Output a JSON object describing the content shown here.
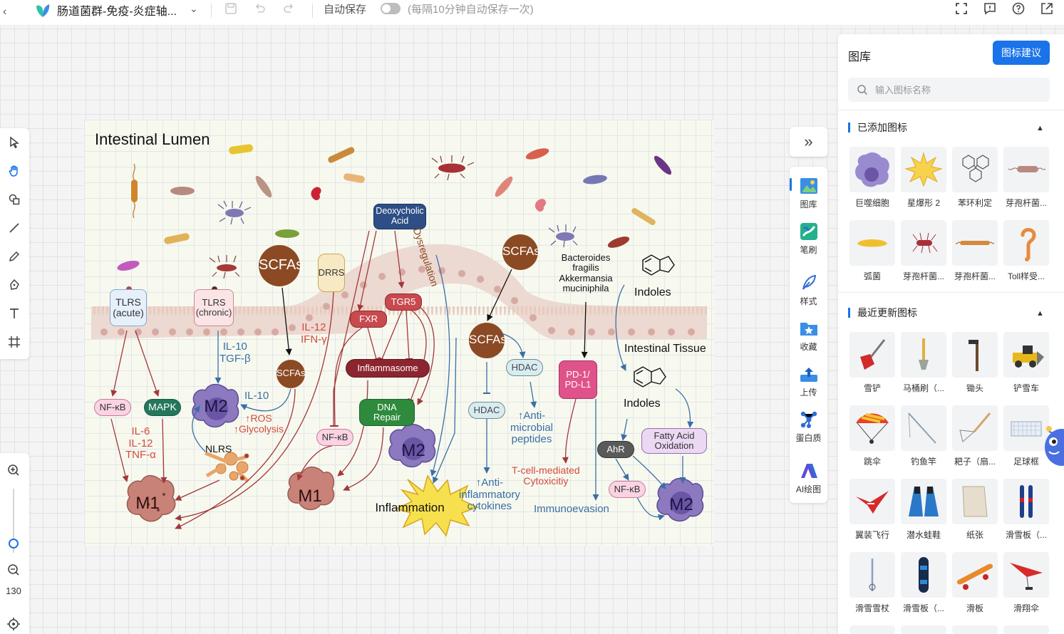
{
  "topbar": {
    "back": "‹",
    "doc_title": "肠道菌群-免疫-炎症轴...",
    "autosave_label": "自动保存",
    "autosave_enabled": false,
    "autosave_hint": "(每隔10分钟自动保存一次)"
  },
  "left_toolbar": {
    "tools": [
      "select-tool",
      "hand-tool",
      "shape-tool",
      "line-tool",
      "pencil-tool",
      "pen-tool",
      "text-tool",
      "frame-tool"
    ],
    "active_tool": "hand-tool"
  },
  "zoom": {
    "value": "130"
  },
  "diagram": {
    "lumen_title": "Intestinal Lumen",
    "tissue_label": "Intestinal Tissue",
    "tlrs_acute": "TLRS\n(acute)",
    "tlrs_chronic": "TLRS\n(chronic)",
    "drrs": "DRRS",
    "scfas": "SCFAs",
    "deoxycholic": "Deoxycholic\nAcid",
    "dysregulation": "Dysregulation",
    "bacteroides": "Bacteroides\nfragilis\nAkkermansia\nmuciniphila",
    "indoles": "Indoles",
    "nfkb": "NF-κB",
    "mapk": "MAPK",
    "il10_tgfb": "IL-10\nTGF-β",
    "il10": "IL-10",
    "ros_glycolysis": "↑ROS\n↑Glycolysis",
    "il12_ifng": "IL-12\nIFN-γ",
    "fxr": "FXR",
    "tgr5": "TGR5",
    "inflammasome": "Inflammasome",
    "dna_repair": "DNA\nRepair",
    "hdac": "HDAC",
    "anti_microbial": "↑Anti-\nmicrobial\npeptides",
    "anti_inflammatory": "↑Anti-\ninflammatory\ncytokines",
    "pd1": "PD-1/\nPD-L1",
    "tcell": "T-cell-mediated\nCytoxicitiy",
    "immunoevasion": "Immunoevasion",
    "ahr": "AhR",
    "fatty_acid": "Fatty Acid\nOxidation",
    "cytokines": "IL-6\nIL-12\nTNF-α",
    "nlrs": "NLRS",
    "m1": "M1",
    "m2": "M2",
    "inflammation": "Inflammation"
  },
  "side_strip": {
    "collapse": "»",
    "items": [
      {
        "label": "图库",
        "icon": "gallery-icon"
      },
      {
        "label": "笔刷",
        "icon": "brush-icon"
      },
      {
        "label": "样式",
        "icon": "feather-style-icon"
      },
      {
        "label": "收藏",
        "icon": "star-folder-icon"
      },
      {
        "label": "上传",
        "icon": "upload-icon"
      },
      {
        "label": "蛋白质",
        "icon": "protein-icon"
      },
      {
        "label": "AI绘图",
        "icon": "ai-draw-icon"
      }
    ]
  },
  "right_panel": {
    "title": "图库",
    "suggest_button": "图标建议",
    "search_placeholder": "输入图标名称",
    "added_section": "已添加图标",
    "recent_section": "最近更新图标",
    "added_icons": [
      {
        "label": "巨噬细胞",
        "icon": "macrophage-icon"
      },
      {
        "label": "星爆形 2",
        "icon": "starburst-icon"
      },
      {
        "label": "苯环利定",
        "icon": "phencyclidine-icon"
      },
      {
        "label": "芽孢杆菌...",
        "icon": "bacillus-icon"
      },
      {
        "label": "弧菌",
        "icon": "vibrio-icon"
      },
      {
        "label": "芽孢杆菌...",
        "icon": "flagellated-bacillus-icon"
      },
      {
        "label": "芽孢杆菌...",
        "icon": "chain-bacillus-icon"
      },
      {
        "label": "Toll样受...",
        "icon": "toll-receptor-icon"
      }
    ],
    "recent_icons": [
      {
        "label": "雪铲",
        "icon": "snow-shovel-icon"
      },
      {
        "label": "马桶刷（...",
        "icon": "toilet-brush-icon"
      },
      {
        "label": "锄头",
        "icon": "hoe-icon"
      },
      {
        "label": "铲雪车",
        "icon": "snowplow-icon"
      },
      {
        "label": "跳伞",
        "icon": "parachute-icon"
      },
      {
        "label": "钓鱼竿",
        "icon": "fishing-rod-icon"
      },
      {
        "label": "耙子（扇...",
        "icon": "rake-icon"
      },
      {
        "label": "足球框",
        "icon": "soccer-goal-icon"
      },
      {
        "label": "翼装飞行",
        "icon": "wingsuit-icon"
      },
      {
        "label": "潜水蛙鞋",
        "icon": "diving-fins-icon"
      },
      {
        "label": "纸张",
        "icon": "paper-icon"
      },
      {
        "label": "滑雪板（...",
        "icon": "skis-icon"
      },
      {
        "label": "滑雪雪杖",
        "icon": "ski-pole-icon"
      },
      {
        "label": "滑雪板（...",
        "icon": "snowboard-icon"
      },
      {
        "label": "滑板",
        "icon": "skateboard-icon"
      },
      {
        "label": "滑翔伞",
        "icon": "hang-glider-icon"
      }
    ]
  }
}
